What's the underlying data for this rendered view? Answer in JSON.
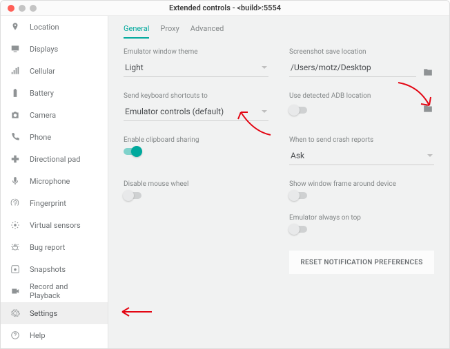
{
  "window": {
    "title": "Extended controls - <build>:5554"
  },
  "traffic": {
    "close": "#ff5f57",
    "min": "#c4c4c4",
    "max": "#c4c4c4"
  },
  "sidebar": {
    "items": [
      {
        "label": "Location",
        "icon": "location"
      },
      {
        "label": "Displays",
        "icon": "displays"
      },
      {
        "label": "Cellular",
        "icon": "cellular"
      },
      {
        "label": "Battery",
        "icon": "battery"
      },
      {
        "label": "Camera",
        "icon": "camera"
      },
      {
        "label": "Phone",
        "icon": "phone"
      },
      {
        "label": "Directional pad",
        "icon": "dpad"
      },
      {
        "label": "Microphone",
        "icon": "mic"
      },
      {
        "label": "Fingerprint",
        "icon": "fingerprint"
      },
      {
        "label": "Virtual sensors",
        "icon": "sensors"
      },
      {
        "label": "Bug report",
        "icon": "bug"
      },
      {
        "label": "Snapshots",
        "icon": "snapshot"
      },
      {
        "label": "Record and Playback",
        "icon": "record"
      },
      {
        "label": "Settings",
        "icon": "settings"
      },
      {
        "label": "Help",
        "icon": "help"
      }
    ],
    "selected": "Settings"
  },
  "tabs": {
    "items": [
      "General",
      "Proxy",
      "Advanced"
    ],
    "active": "General"
  },
  "settings": {
    "theme": {
      "label": "Emulator window theme",
      "value": "Light"
    },
    "shortcuts": {
      "label": "Send keyboard shortcuts to",
      "value": "Emulator controls (default)"
    },
    "clipboard": {
      "label": "Enable clipboard sharing",
      "on": true
    },
    "mouse": {
      "label": "Disable mouse wheel",
      "on": false
    },
    "screenshot": {
      "label": "Screenshot save location",
      "value": "/Users/motz/Desktop"
    },
    "adb": {
      "label": "Use detected ADB location",
      "on": false
    },
    "crash": {
      "label": "When to send crash reports",
      "value": "Ask"
    },
    "frame": {
      "label": "Show window frame around device",
      "on": false
    },
    "ontop": {
      "label": "Emulator always on top",
      "on": false
    },
    "reset": {
      "label": "RESET NOTIFICATION PREFERENCES"
    }
  },
  "annotations": {
    "color": "#e30613"
  }
}
